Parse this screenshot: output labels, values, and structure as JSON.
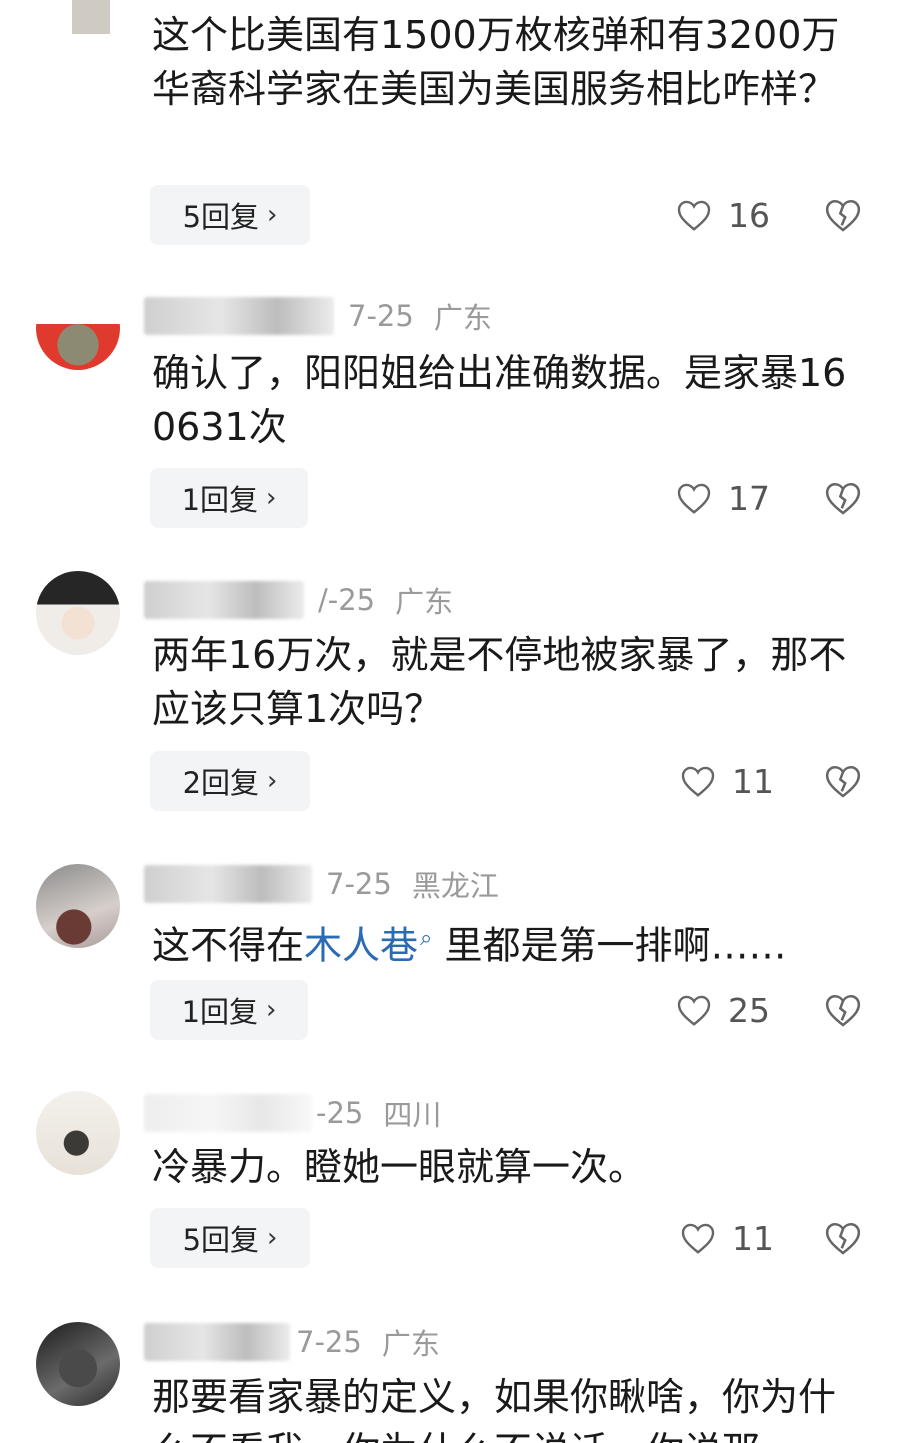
{
  "comments": [
    {
      "author": "",
      "date": "",
      "location": "",
      "text": "这个比美国有1500万枚核弹和有3200万华裔科学家在美国为美国服务相比咋样？",
      "replies": "5回复",
      "likes": "16"
    },
    {
      "author": "",
      "date": "7-25",
      "location": "广东",
      "text": "确认了，阳阳姐给出准确数据。是家暴160631次",
      "replies": "1回复",
      "likes": "17"
    },
    {
      "author": "",
      "date": "/-25",
      "location": "广东",
      "text": "两年16万次，就是不停地被家暴了，那不应该只算1次吗？",
      "replies": "2回复",
      "likes": "11"
    },
    {
      "author": "",
      "date": "7-25",
      "location": "黑龙江",
      "text_before": "这不得在",
      "link": "木人巷",
      "text_after": " 里都是第一排啊……",
      "replies": "1回复",
      "likes": "25"
    },
    {
      "author": "",
      "date": "-25",
      "location": "四川",
      "text": "冷暴力。瞪她一眼就算一次。",
      "replies": "5回复",
      "likes": "11"
    },
    {
      "author": "",
      "date": "7-25",
      "location": "广东",
      "text": "那要看家暴的定义，如果你瞅啥，你为什么不看我，你为什么不说话，你说那",
      "replies": "",
      "likes": ""
    }
  ],
  "icons": {
    "like": "heart-outline-icon",
    "dislike": "broken-heart-icon",
    "reply_chevron": "chevron-right-icon",
    "search": "search-icon"
  },
  "colors": {
    "link": "#2a6bb3",
    "meta": "#9a9a9a",
    "reply_bg": "#f3f4f6"
  }
}
